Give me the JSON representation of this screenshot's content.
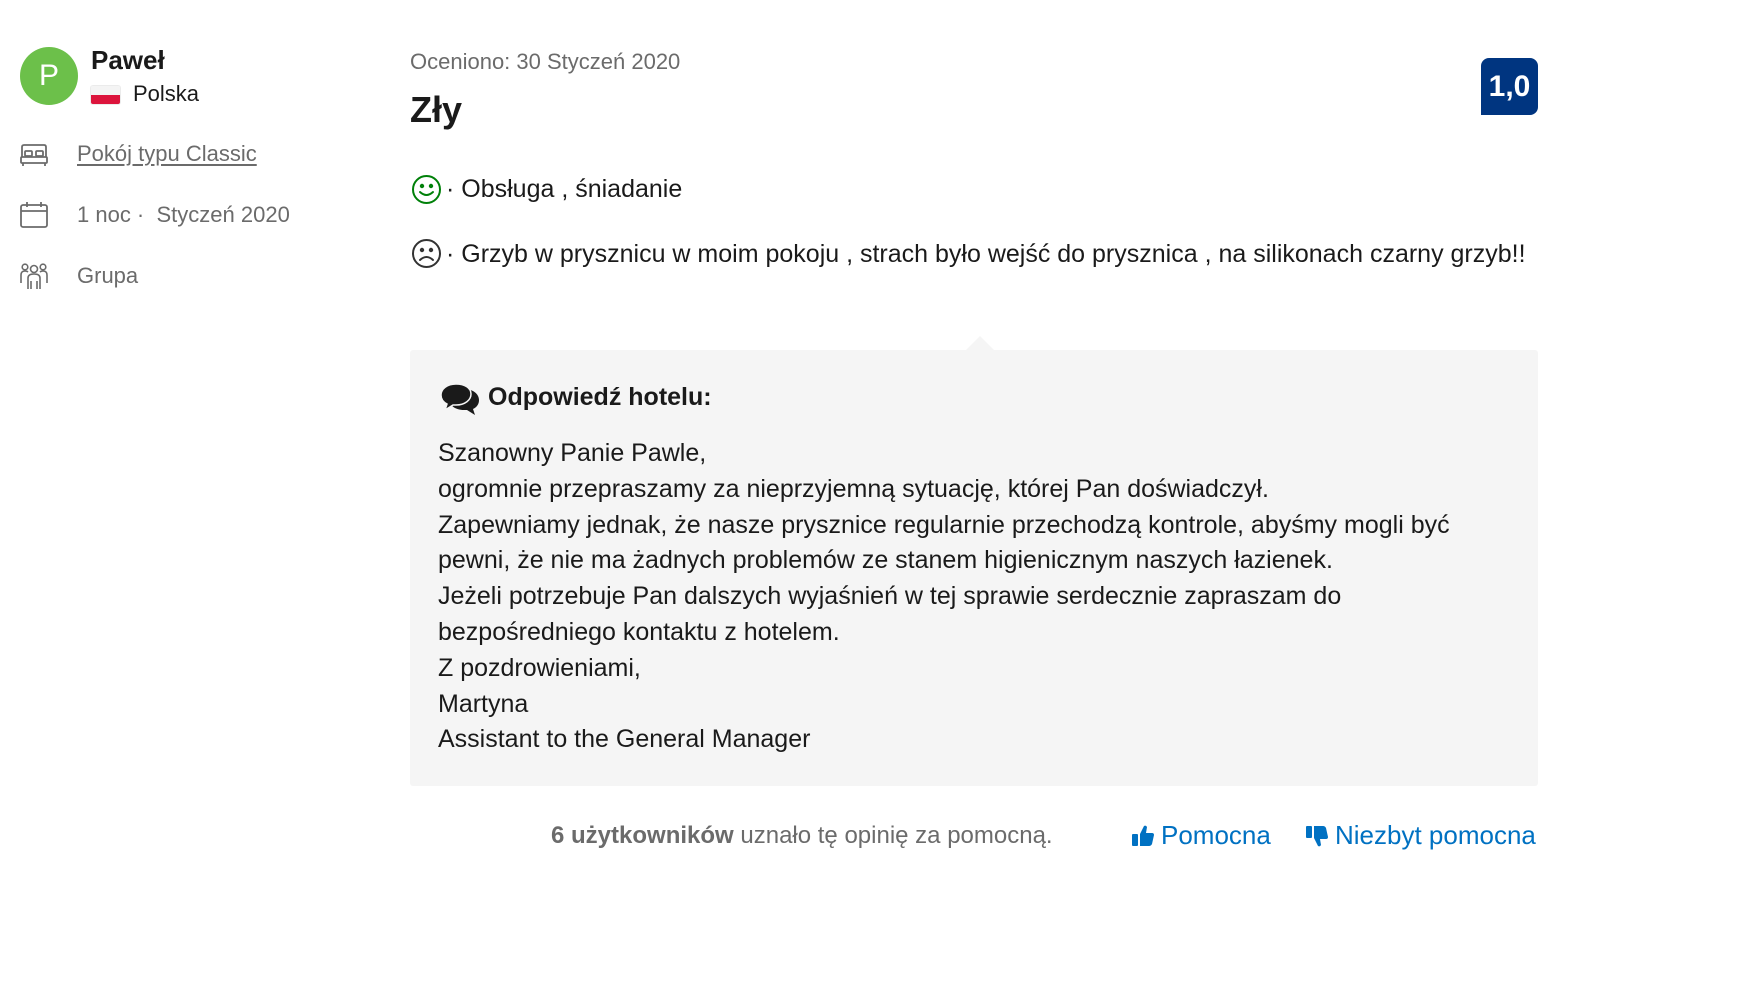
{
  "reviewer": {
    "initial": "P",
    "name": "Paweł",
    "country": "Polska",
    "avatar_color": "#6cc04a"
  },
  "stay_info": {
    "room_type": "Pokój typu Classic",
    "nights": "1 noc ·",
    "stay_date": "Styczeń 2020",
    "traveler_type": "Grupa"
  },
  "review": {
    "date_label": "Oceniono: 30 Styczeń 2020",
    "title": "Zły",
    "score": "1,0",
    "score_color": "#003580",
    "positive": "· Obsługa , śniadanie",
    "negative": "· Grzyb w prysznicu w moim pokoju , strach było wejść do prysznica , na silikonach czarny grzyb!!"
  },
  "hotel_response": {
    "heading": "Odpowiedź hotelu:",
    "lines": [
      "Szanowny Panie Pawle,",
      "ogromnie przepraszamy za nieprzyjemną sytuację, której Pan doświadczył.",
      "Zapewniamy jednak, że nasze prysznice regularnie przechodzą kontrole, abyśmy mogli być pewni, że nie ma żadnych problemów ze stanem higienicznym naszych łazienek.",
      "Jeżeli potrzebuje Pan dalszych wyjaśnień w tej sprawie serdecznie zapraszam do bezpośredniego kontaktu z hotelem.",
      "Z pozdrowieniami,",
      "Martyna",
      "Assistant to the General Manager"
    ]
  },
  "footer": {
    "helpful_count": "6 użytkowników",
    "helpful_suffix": "uznało tę opinię za pomocną.",
    "helpful_button": "Pomocna",
    "not_helpful_button": "Niezbyt pomocna",
    "link_color": "#0071c2"
  },
  "icons": {
    "room": "bed-icon",
    "date": "calendar-icon",
    "group": "group-icon",
    "positive": "smile-icon",
    "negative": "frown-icon",
    "response": "speech-bubbles-icon",
    "helpful": "thumbs-up-icon",
    "not_helpful": "thumbs-down-icon"
  }
}
